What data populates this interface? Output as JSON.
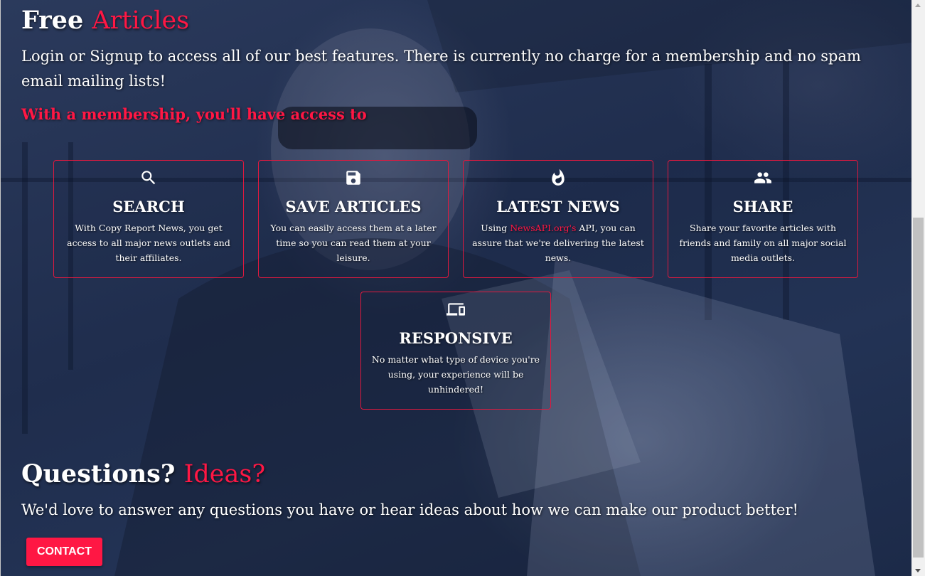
{
  "features_section": {
    "heading_part1": "Free",
    "heading_part2": "Articles",
    "intro": "Login or Signup to access all of our best features. There is currently no charge for a membership and no spam email mailing lists!",
    "subheading": "With a membership, you'll have access to",
    "cards": [
      {
        "icon": "search-icon",
        "title": "SEARCH",
        "description": "With Copy Report News, you get access to all major news outlets and their affiliates."
      },
      {
        "icon": "save-icon",
        "title": "SAVE ARTICLES",
        "description": "You can easily access them at a later time so you can read them at your leisure."
      },
      {
        "icon": "fire-icon",
        "title": "LATEST NEWS",
        "description_before": "Using ",
        "description_link": "NewsAPI.org's",
        "description_after": " API, you can assure that we're delivering the latest news."
      },
      {
        "icon": "people-icon",
        "title": "SHARE",
        "description": "Share your favorite articles with friends and family on all major social media outlets."
      },
      {
        "icon": "devices-icon",
        "title": "RESPONSIVE",
        "description": "No matter what type of device you're using, your experience will be unhindered!"
      }
    ]
  },
  "contact_section": {
    "heading_part1": "Questions?",
    "heading_part2": "Ideas?",
    "text": "We'd love to answer any questions you have or hear ideas about how we can make our product better!",
    "button_label": "CONTACT"
  },
  "colors": {
    "accent": "#ff1744",
    "overlay": "#1f2d4d"
  }
}
